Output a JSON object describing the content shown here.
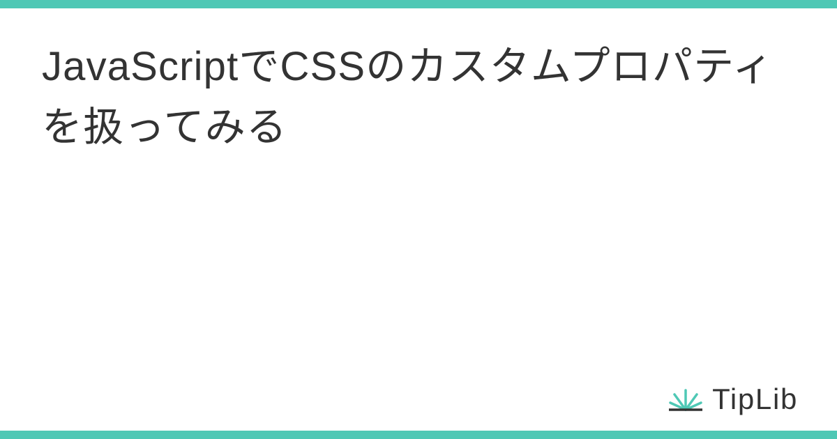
{
  "title": "JavaScriptでCSSのカスタムプロパティを扱ってみる",
  "brand": {
    "name": "TipLib",
    "icon_name": "sunburst-icon"
  },
  "colors": {
    "accent": "#4fc8b5",
    "text": "#333333",
    "background": "#ffffff"
  }
}
